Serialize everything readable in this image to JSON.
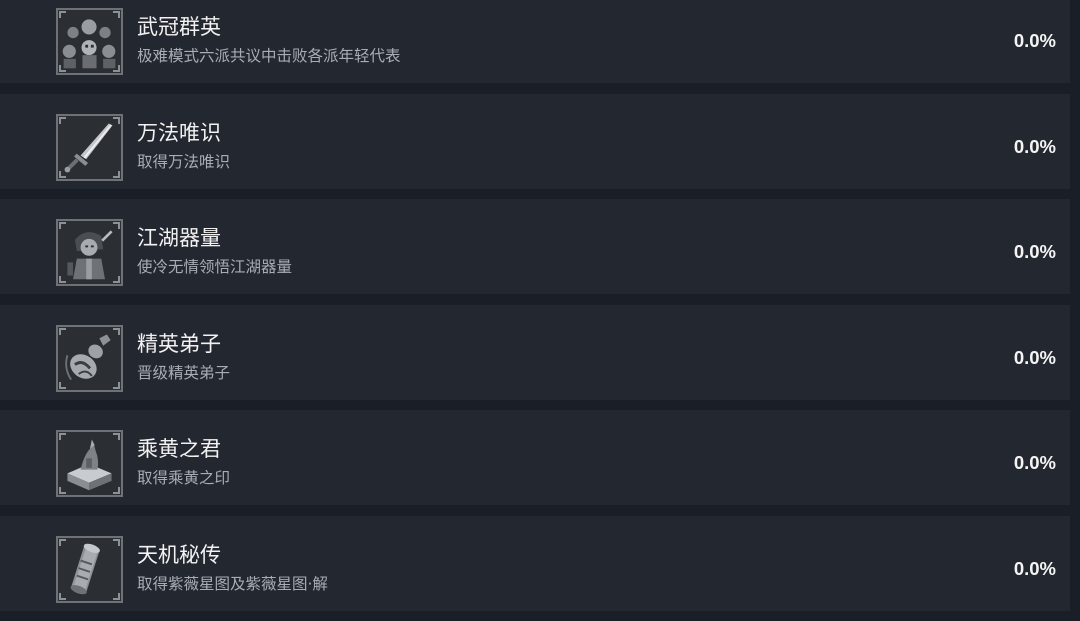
{
  "achievements": [
    {
      "title": "武冠群英",
      "desc": "极难模式六派共议中击败各派年轻代表",
      "percent": "0.0%",
      "icon": "group-portrait-icon"
    },
    {
      "title": "万法唯识",
      "desc": "取得万法唯识",
      "percent": "0.0%",
      "icon": "sword-icon"
    },
    {
      "title": "江湖器量",
      "desc": "使冷无情领悟江湖器量",
      "percent": "0.0%",
      "icon": "warrior-portrait-icon"
    },
    {
      "title": "精英弟子",
      "desc": "晋级精英弟子",
      "percent": "0.0%",
      "icon": "gourd-icon"
    },
    {
      "title": "乘黄之君",
      "desc": "取得乘黄之印",
      "percent": "0.0%",
      "icon": "seal-icon"
    },
    {
      "title": "天机秘传",
      "desc": "取得紫薇星图及紫薇星图·解",
      "percent": "0.0%",
      "icon": "scroll-icon"
    }
  ]
}
